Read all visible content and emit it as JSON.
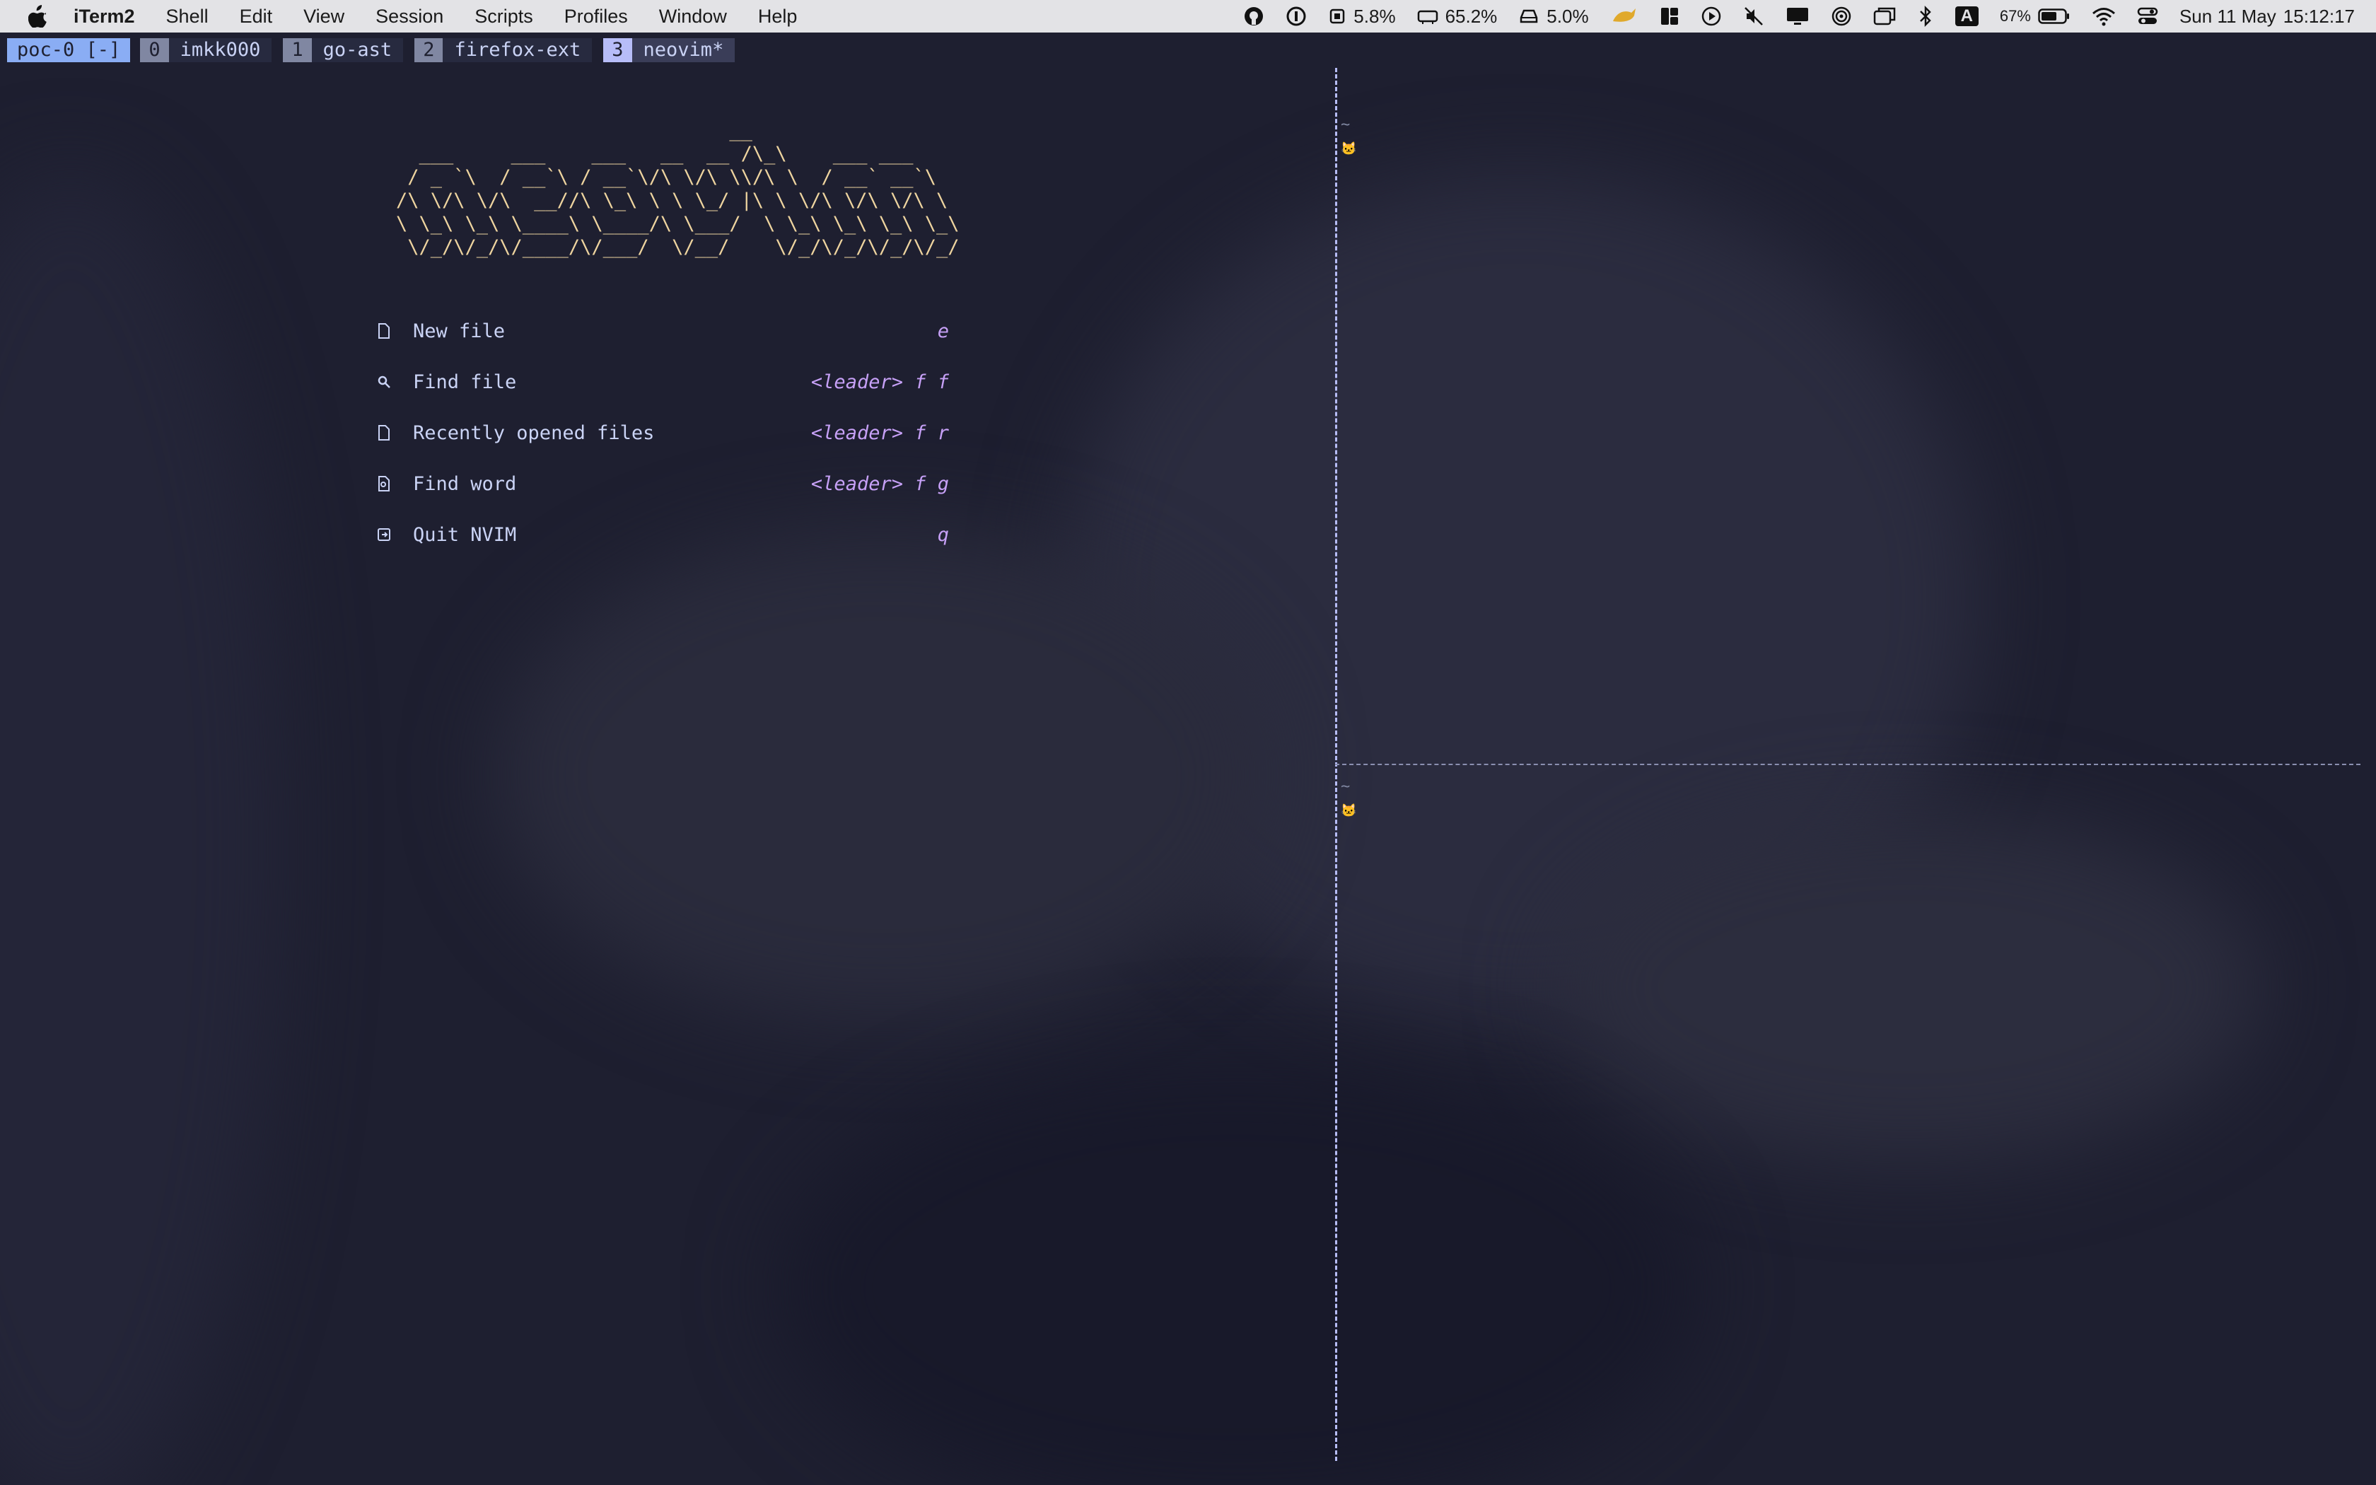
{
  "menubar": {
    "app_name": "iTerm2",
    "menus": [
      "Shell",
      "Edit",
      "View",
      "Session",
      "Scripts",
      "Profiles",
      "Window",
      "Help"
    ],
    "status": {
      "cpu": "5.8%",
      "memory": "65.2%",
      "disk": "5.0%",
      "keyboard_input": "A",
      "battery": "67%",
      "date": "Sun 11 May",
      "time": "15:12:17"
    },
    "icons": [
      "apple-icon",
      "github-icon",
      "1password-icon",
      "cpu-icon",
      "memory-icon",
      "disk-icon",
      "runcat-icon",
      "layout-icon",
      "play-icon",
      "mute-icon",
      "display-icon",
      "airdrop-icon",
      "window-icon",
      "bluetooth-icon",
      "input-source-icon",
      "battery-icon",
      "wifi-icon",
      "control-center-icon"
    ]
  },
  "tmux": {
    "session": "poc-0 [-]",
    "windows": [
      {
        "index": "0",
        "name": "imkk000"
      },
      {
        "index": "1",
        "name": "go-ast"
      },
      {
        "index": "2",
        "name": "firefox-ext"
      },
      {
        "index": "3",
        "name": "neovim*"
      }
    ],
    "active_color": "#8aadf4"
  },
  "dashboard": {
    "logo": "                             __\n  ___     ___    ___   __  __ /\\_\\    ___ ___\n / _ `\\  / __`\\ / __`\\/\\ \\/\\ \\\\/\\ \\  / __` __`\\\n/\\ \\/\\ \\/\\  __//\\ \\_\\ \\ \\ \\_/ |\\ \\ \\/\\ \\/\\ \\/\\ \\\n\\ \\_\\ \\_\\ \\____\\ \\____/\\ \\___/  \\ \\_\\ \\_\\ \\_\\ \\_\\\n \\/_/\\/_/\\/____/\\/___/  \\/__/    \\/_/\\/_/\\/_/\\/_/",
    "items": [
      {
        "icon": "file-icon",
        "label": "New file",
        "key": "e"
      },
      {
        "icon": "search-icon",
        "label": "Find file",
        "key": "<leader> f f"
      },
      {
        "icon": "file-icon",
        "label": "Recently opened files",
        "key": "<leader> f r"
      },
      {
        "icon": "find-word-icon",
        "label": "Find word",
        "key": "<leader> f g"
      },
      {
        "icon": "quit-icon",
        "label": "Quit NVIM",
        "key": "q"
      }
    ],
    "logo_color": "#eed49f",
    "key_color": "#c6a0f6"
  },
  "panes": {
    "top_right": {
      "empty_line": "~"
    },
    "bottom_right": {
      "empty_line": "~"
    }
  }
}
